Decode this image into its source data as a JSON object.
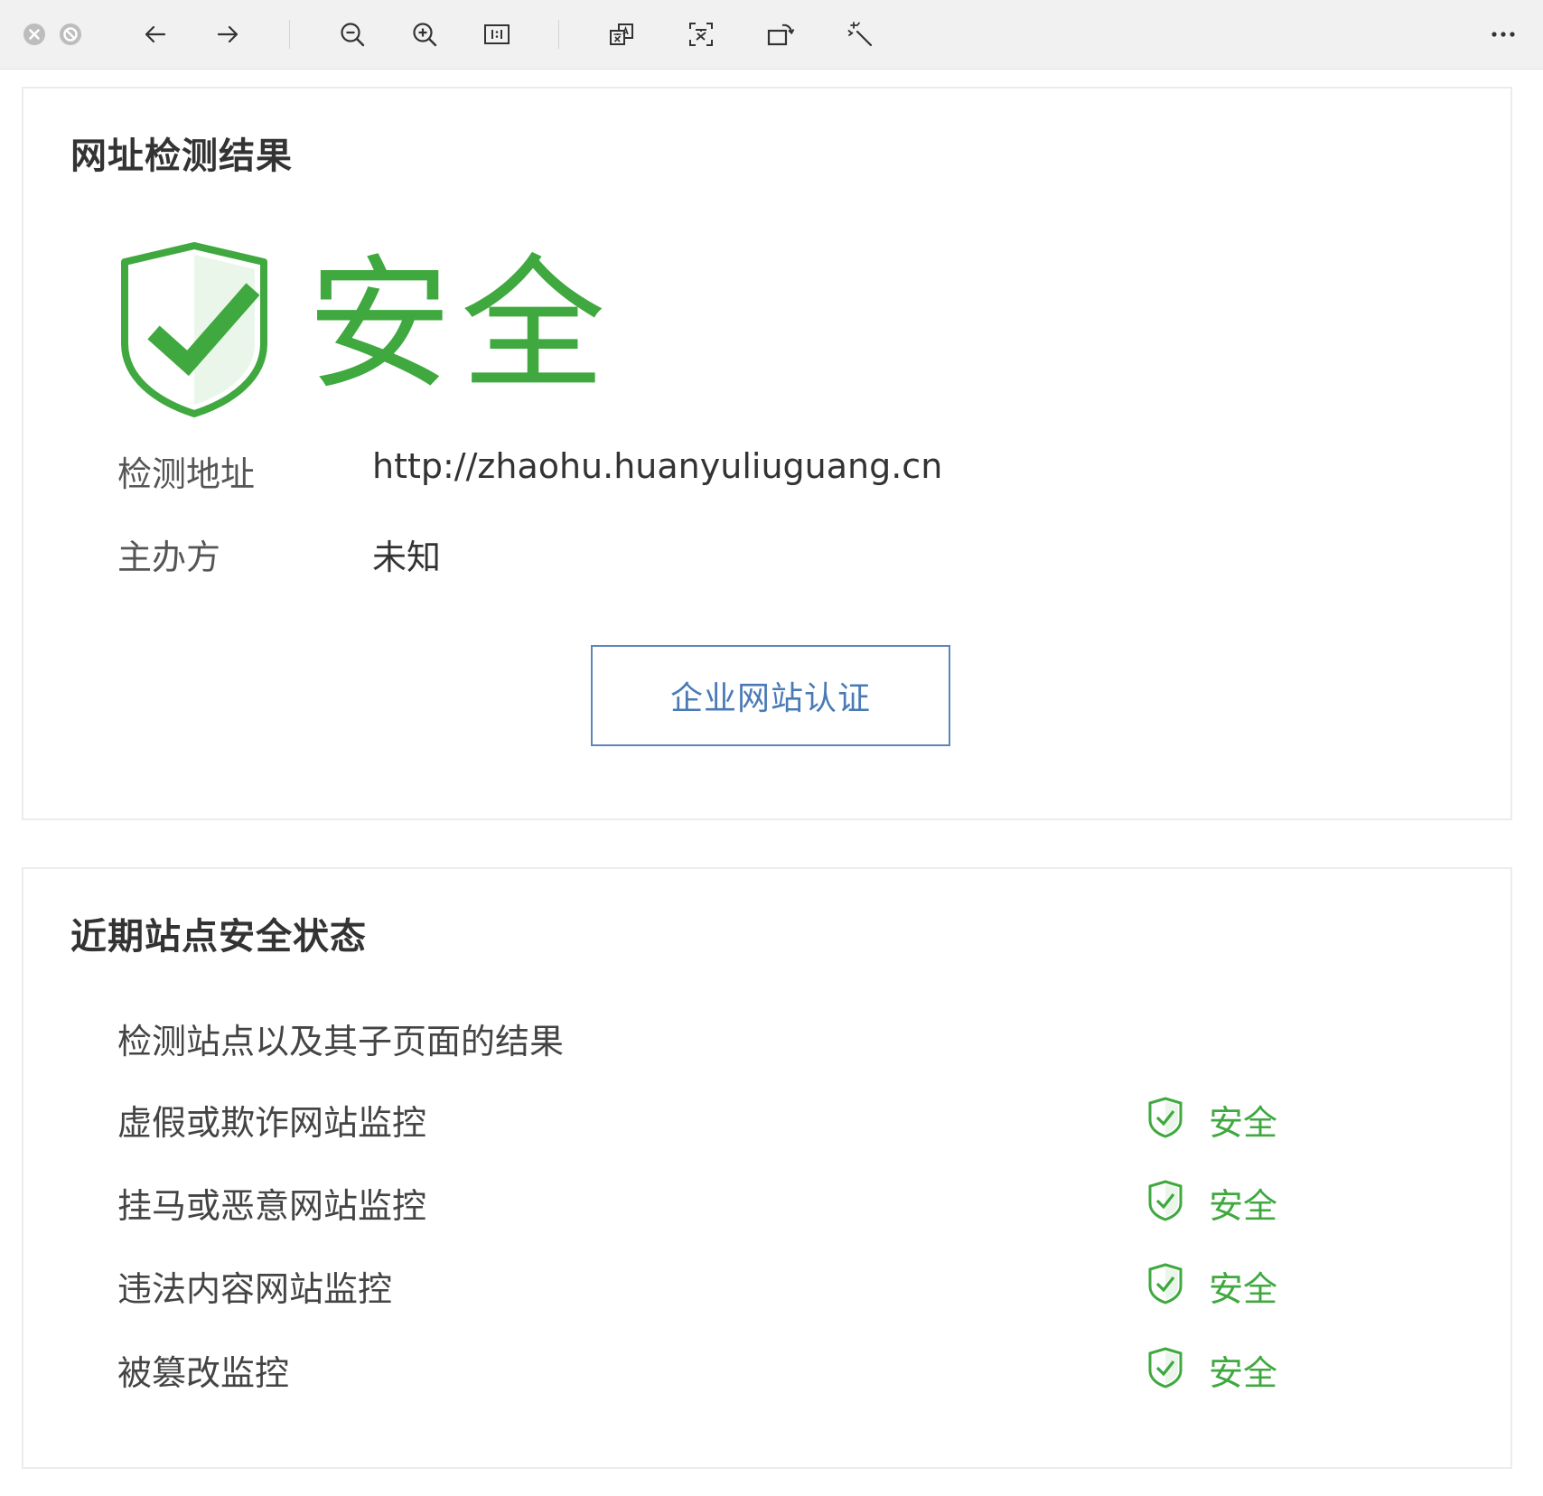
{
  "colors": {
    "safe_green": "#3fa83f",
    "button_blue": "#4a7ab5",
    "toolbar_bg": "#f1f1f1"
  },
  "toolbar": {
    "icons": [
      "close-icon",
      "block-icon",
      "back-arrow-icon",
      "forward-arrow-icon",
      "zoom-out-icon",
      "zoom-in-icon",
      "actual-size-icon",
      "translate-icon",
      "text-recognition-icon",
      "rotate-icon",
      "magic-wand-icon",
      "more-icon"
    ]
  },
  "result_card": {
    "title": "网址检测结果",
    "status": "安全",
    "url_label": "检测地址",
    "url_value": "http://zhaohu.huanyuliuguang.cn",
    "org_label": "主办方",
    "org_value": "未知",
    "cert_button": "企业网站认证"
  },
  "status_card": {
    "title": "近期站点安全状态",
    "intro": "检测站点以及其子页面的结果",
    "items": [
      {
        "label": "虚假或欺诈网站监控",
        "status": "安全"
      },
      {
        "label": "挂马或恶意网站监控",
        "status": "安全"
      },
      {
        "label": "违法内容网站监控",
        "status": "安全"
      },
      {
        "label": "被篡改监控",
        "status": "安全"
      }
    ]
  }
}
